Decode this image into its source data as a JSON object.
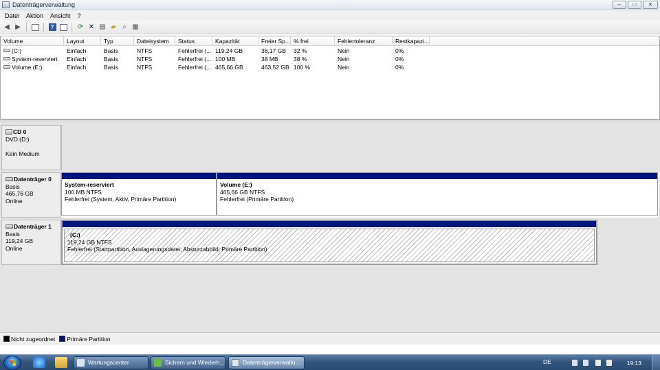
{
  "window": {
    "title": "Datenträgerverwaltung",
    "buttons": {
      "minimize": "–",
      "maximize": "□",
      "close": "✕"
    }
  },
  "menu": [
    "Datei",
    "Aktion",
    "Ansicht",
    "?"
  ],
  "toolbar": {
    "icons": [
      "back-arrow-icon",
      "forward-arrow-icon",
      "console-tree-icon",
      "help-icon",
      "properties-list-icon",
      "refresh-icon",
      "delete-icon",
      "properties-icon",
      "open-icon",
      "explore-icon",
      "volume-properties-icon"
    ]
  },
  "volume_list": {
    "columns": [
      "Volume",
      "Layout",
      "Typ",
      "Dateisystem",
      "Status",
      "Kapazität",
      "Freier Sp...",
      "% frei",
      "Fehlertoleranz",
      "Restkapazi..."
    ],
    "rows": [
      [
        "(C:)",
        "Einfach",
        "Basis",
        "NTFS",
        "Fehlerfrei (...",
        "119,24 GB",
        "38,17 GB",
        "32 %",
        "Nein",
        "0%"
      ],
      [
        "System-reserviert",
        "Einfach",
        "Basis",
        "NTFS",
        "Fehlerfrei (...",
        "100 MB",
        "38 MB",
        "38 %",
        "Nein",
        "0%"
      ],
      [
        "Volume (E:)",
        "Einfach",
        "Basis",
        "NTFS",
        "Fehlerfrei (...",
        "465,66 GB",
        "463,52 GB",
        "100 %",
        "Nein",
        "0%"
      ]
    ]
  },
  "disks": {
    "cd0": {
      "name": "CD 0",
      "line1": "DVD (D:)",
      "line2": "",
      "line3": "Kein Medium"
    },
    "disk0": {
      "name": "Datenträger 0",
      "type": "Basis",
      "size": "465,76 GB",
      "state": "Online",
      "partitions": [
        {
          "name": "System-reserviert",
          "size": "100 MB NTFS",
          "status": "Fehlerfrei (System, Aktiv, Primäre Partition)"
        },
        {
          "name": "Volume  (E:)",
          "size": "465,66 GB NTFS",
          "status": "Fehlerfrei (Primäre Partition)"
        }
      ]
    },
    "disk1": {
      "name": "Datenträger 1",
      "type": "Basis",
      "size": "119,24 GB",
      "state": "Online",
      "partitions": [
        {
          "name": "(C:)",
          "size": "119,24 GB NTFS",
          "status": "Fehlerfrei (Startpartition, Auslagerungsdatei, Absturzabbild, Primäre Partition)"
        }
      ]
    }
  },
  "legend": {
    "items": [
      {
        "label": "Nicht zugeordnet",
        "color": "#000000"
      },
      {
        "label": "Primäre Partition",
        "color": "#00137f"
      }
    ]
  },
  "taskbar": {
    "buttons": [
      "Wartungscenter",
      "Sichern und Wiederh...",
      "Datenträgerverwaltu..."
    ],
    "language": "DE",
    "clock": "19:13"
  }
}
